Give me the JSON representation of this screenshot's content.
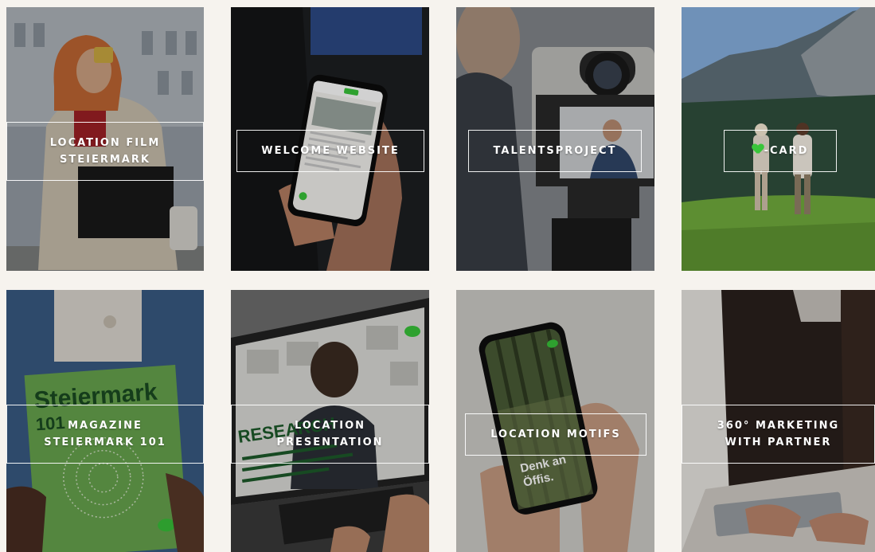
{
  "tiles": [
    {
      "line1": "LOCATION FILM",
      "line2": "STEIERMARK"
    },
    {
      "line1": "WELCOME WEBSITE",
      "line2": ""
    },
    {
      "line1": "TALENTSPROJECT",
      "line2": ""
    },
    {
      "line1": "-CARD",
      "line2": "",
      "icon": "green-heart-icon"
    },
    {
      "line1": "MAGAZINE",
      "line2": "STEIERMARK 101"
    },
    {
      "line1": "LOCATION",
      "line2": "PRESENTATION"
    },
    {
      "line1": "LOCATION MOTIFS",
      "line2": ""
    },
    {
      "line1": "360° MARKETING",
      "line2": "WITH PARTNER"
    }
  ],
  "photo_texts": {
    "magazine_title": "Steiermark",
    "magazine_number": "101",
    "research": "RESEARCH",
    "phone_text_1": "Denk an",
    "phone_text_2": "Öffis."
  },
  "colors": {
    "page_background": "#f6f3ee",
    "label_border": "#ffffff",
    "brand_green": "#39c53a"
  }
}
